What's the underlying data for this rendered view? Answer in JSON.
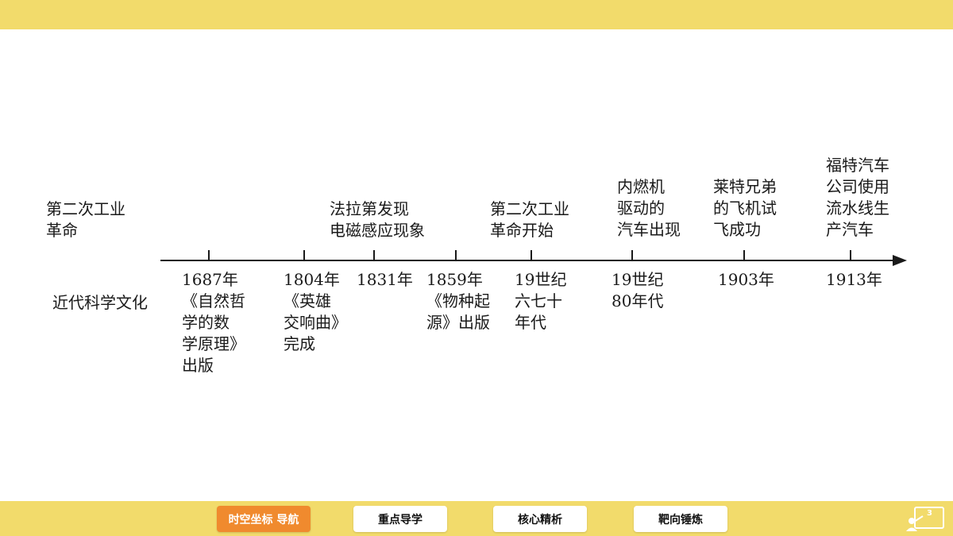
{
  "labels": {
    "top": "第二次工业\n革命",
    "bottom": "近代科学文化"
  },
  "timeline": {
    "above": [
      {
        "text": "法拉第发现\n电磁感应现象"
      },
      {
        "text": "第二次工业\n革命开始"
      },
      {
        "text": "内燃机\n驱动的\n汽车出现"
      },
      {
        "text": "莱特兄弟\n的飞机试\n飞成功"
      },
      {
        "text": "福特汽车\n公司使用\n流水线生\n产汽车"
      }
    ],
    "below": [
      {
        "text": "1687年\n《自然哲\n学的数\n学原理》\n出版"
      },
      {
        "text": "1804年\n《英雄\n交响曲》\n完成"
      },
      {
        "text": "1831年"
      },
      {
        "text": "1859年\n《物种起\n源》出版"
      },
      {
        "text": "19世纪\n六七十\n年代"
      },
      {
        "text": "19世纪\n80年代"
      },
      {
        "text": "1903年"
      },
      {
        "text": "1913年"
      }
    ]
  },
  "nav": {
    "items": [
      "时空坐标  导航",
      "重点导学",
      "核心精析",
      "靶向锤炼"
    ],
    "active_index": 0,
    "page_number": "3"
  },
  "colors": {
    "band": "#f2db6b",
    "active": "#f08a2e",
    "axis": "#1a1a1a"
  }
}
